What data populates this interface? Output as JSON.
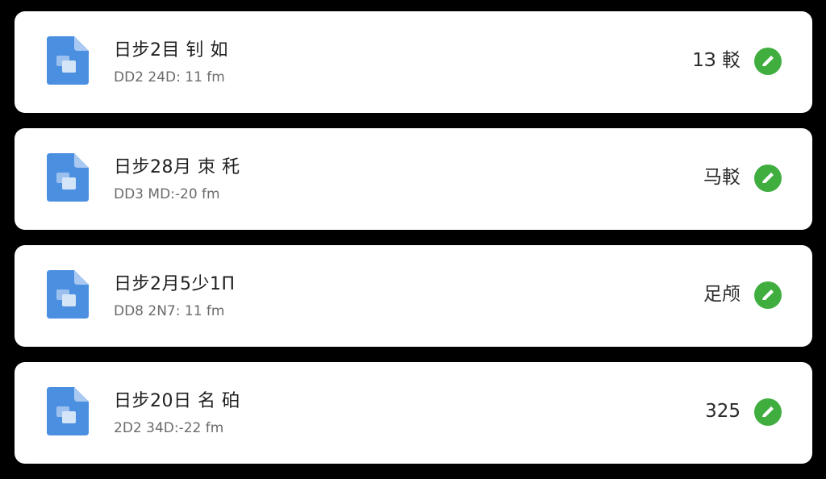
{
  "items": [
    {
      "title": "日步2目 钊 如",
      "subtitle": "DD2 24D: 11 fm",
      "value": "1З 䡈",
      "icon": "document-icon",
      "status_icon": "check-icon"
    },
    {
      "title": "日步28月 朿 秅",
      "subtitle": "DD3 MD:-20 fm",
      "value": "马䡈",
      "icon": "document-icon",
      "status_icon": "check-icon"
    },
    {
      "title": "日步2月5少1П",
      "subtitle": "DD8 2N7: 11 fm",
      "value": "足颅",
      "icon": "document-icon",
      "status_icon": "check-icon"
    },
    {
      "title": "日步20日 名 砶",
      "subtitle": "2D2 34D:-22 fm",
      "value": "325",
      "icon": "document-icon",
      "status_icon": "check-icon"
    }
  ],
  "colors": {
    "background": "#000000",
    "card": "#ffffff",
    "icon_blue": "#4a8fe0",
    "check_green": "#3fae3f"
  }
}
